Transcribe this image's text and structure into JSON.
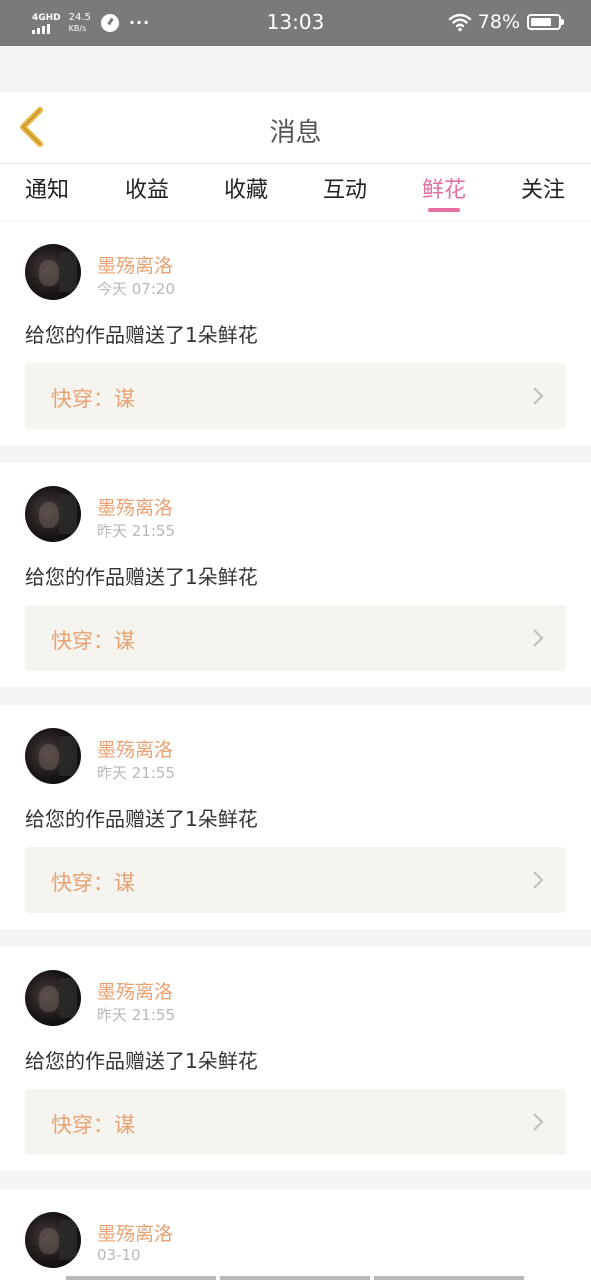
{
  "status_bar": {
    "network_type": "4GHD",
    "speed_value": "24.5",
    "speed_unit": "KB/s",
    "time": "13:03",
    "battery": "78%",
    "icons": [
      "signal-icon",
      "gauge-icon",
      "more-icon",
      "wifi-icon",
      "battery-icon"
    ]
  },
  "header": {
    "title": "消息",
    "back_icon": "back-chevron-icon",
    "back_color": "#e8b43a"
  },
  "tabs": [
    {
      "label": "通知",
      "active": false
    },
    {
      "label": "收益",
      "active": false
    },
    {
      "label": "收藏",
      "active": false
    },
    {
      "label": "互动",
      "active": false
    },
    {
      "label": "鲜花",
      "active": true
    },
    {
      "label": "关注",
      "active": false
    }
  ],
  "colors": {
    "accent_pink": "#e46fa0",
    "name_orange": "#e8a274",
    "card_bg": "#f5f4ee"
  },
  "messages": [
    {
      "user": "墨殇离洛",
      "time": "今天 07:20",
      "text": "给您的作品赠送了1朵鲜花",
      "work": "快穿：谋"
    },
    {
      "user": "墨殇离洛",
      "time": "昨天 21:55",
      "text": "给您的作品赠送了1朵鲜花",
      "work": "快穿：谋"
    },
    {
      "user": "墨殇离洛",
      "time": "昨天 21:55",
      "text": "给您的作品赠送了1朵鲜花",
      "work": "快穿：谋"
    },
    {
      "user": "墨殇离洛",
      "time": "昨天 21:55",
      "text": "给您的作品赠送了1朵鲜花",
      "work": "快穿：谋"
    },
    {
      "user": "墨殇离洛",
      "time": "03-10",
      "text": "",
      "work": ""
    }
  ]
}
